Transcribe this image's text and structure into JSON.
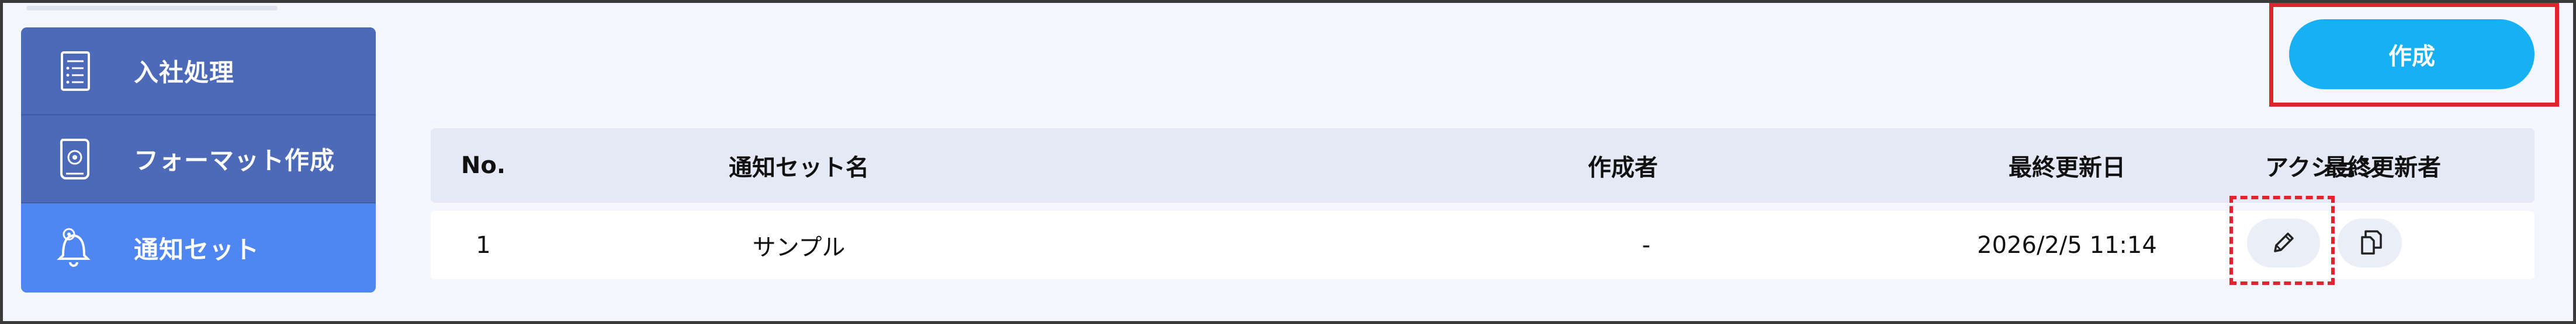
{
  "sidebar": {
    "items": [
      {
        "label": "入社処理",
        "icon": "document-list-icon",
        "active": false
      },
      {
        "label": "フォーマット作成",
        "icon": "format-document-icon",
        "active": false
      },
      {
        "label": "通知セット",
        "icon": "bell-gear-icon",
        "active": true
      }
    ]
  },
  "toolbar": {
    "create_label": "作成"
  },
  "table": {
    "headers": {
      "no": "No.",
      "name": "通知セット名",
      "creator": "作成者",
      "updated": "最終更新日",
      "updater": "最終更新者",
      "action": "アクション"
    },
    "rows": [
      {
        "no": "1",
        "name": "サンプル",
        "creator": "-",
        "updated": "2026/2/5 11:14",
        "updater": "-"
      }
    ]
  },
  "colors": {
    "sidebar_bg": "#4c6ab8",
    "sidebar_active": "#4f86f2",
    "create_button": "#17b1f3",
    "highlight_red": "#e0232e"
  }
}
